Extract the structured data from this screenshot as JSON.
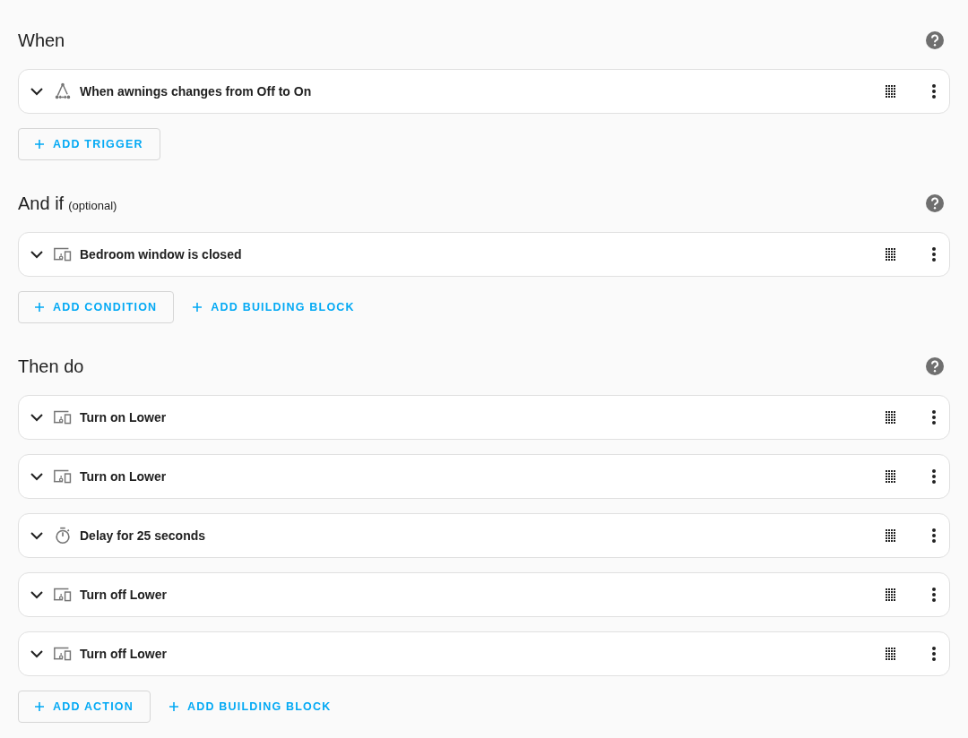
{
  "sections": [
    {
      "title": "When",
      "items": [
        {
          "kind": "trigger",
          "label": "When awnings changes from Off to On"
        }
      ],
      "buttons": [
        {
          "kind": "outlined",
          "label": "ADD TRIGGER"
        }
      ]
    },
    {
      "title": "And if",
      "subtitle": "(optional)",
      "items": [
        {
          "kind": "device",
          "label": "Bedroom window is closed"
        }
      ],
      "buttons": [
        {
          "kind": "outlined",
          "label": "ADD CONDITION"
        },
        {
          "kind": "text",
          "label": "ADD BUILDING BLOCK"
        }
      ]
    },
    {
      "title": "Then do",
      "items": [
        {
          "kind": "device",
          "label": "Turn on Lower"
        },
        {
          "kind": "device",
          "label": "Turn on Lower"
        },
        {
          "kind": "delay",
          "label": "Delay for 25 seconds"
        },
        {
          "kind": "device",
          "label": "Turn off Lower"
        },
        {
          "kind": "device",
          "label": "Turn off Lower"
        }
      ],
      "buttons": [
        {
          "kind": "outlined",
          "label": "ADD ACTION"
        },
        {
          "kind": "text",
          "label": "ADD BUILDING BLOCK"
        }
      ]
    }
  ]
}
